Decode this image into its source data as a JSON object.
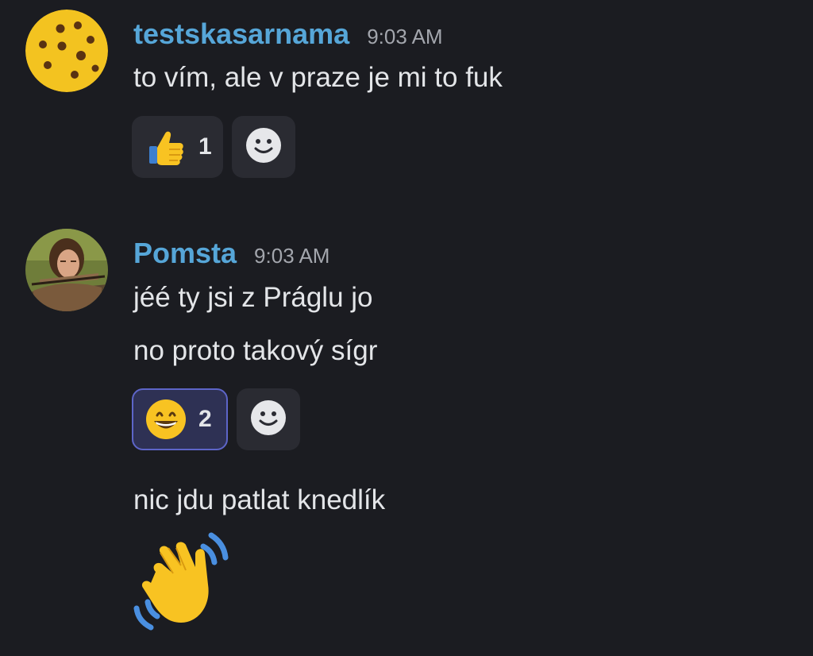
{
  "messages": [
    {
      "username": "testskasarnama",
      "time": "9:03 AM",
      "avatar": "cookie-avatar",
      "lines": [
        "to vím, ale v praze je mi to fuk"
      ],
      "reaction": {
        "emoji": "thumbs-up-icon",
        "count": "1",
        "active": false
      }
    },
    {
      "username": "Pomsta",
      "time": "9:03 AM",
      "avatar": "archer-portrait-avatar",
      "lines": [
        "jéé ty jsi z Práglu jo",
        "no proto takový sígr"
      ],
      "reaction": {
        "emoji": "grinning-face-icon",
        "count": "2",
        "active": true
      }
    },
    {
      "lines": [
        "nic jdu patlat knedlík"
      ],
      "emoji": "waving-hand-icon"
    }
  ],
  "colors": {
    "background": "#1b1c21",
    "username": "#56a6d8",
    "reaction_bg": "#2a2b32",
    "reaction_active_border": "#5d65c8"
  }
}
